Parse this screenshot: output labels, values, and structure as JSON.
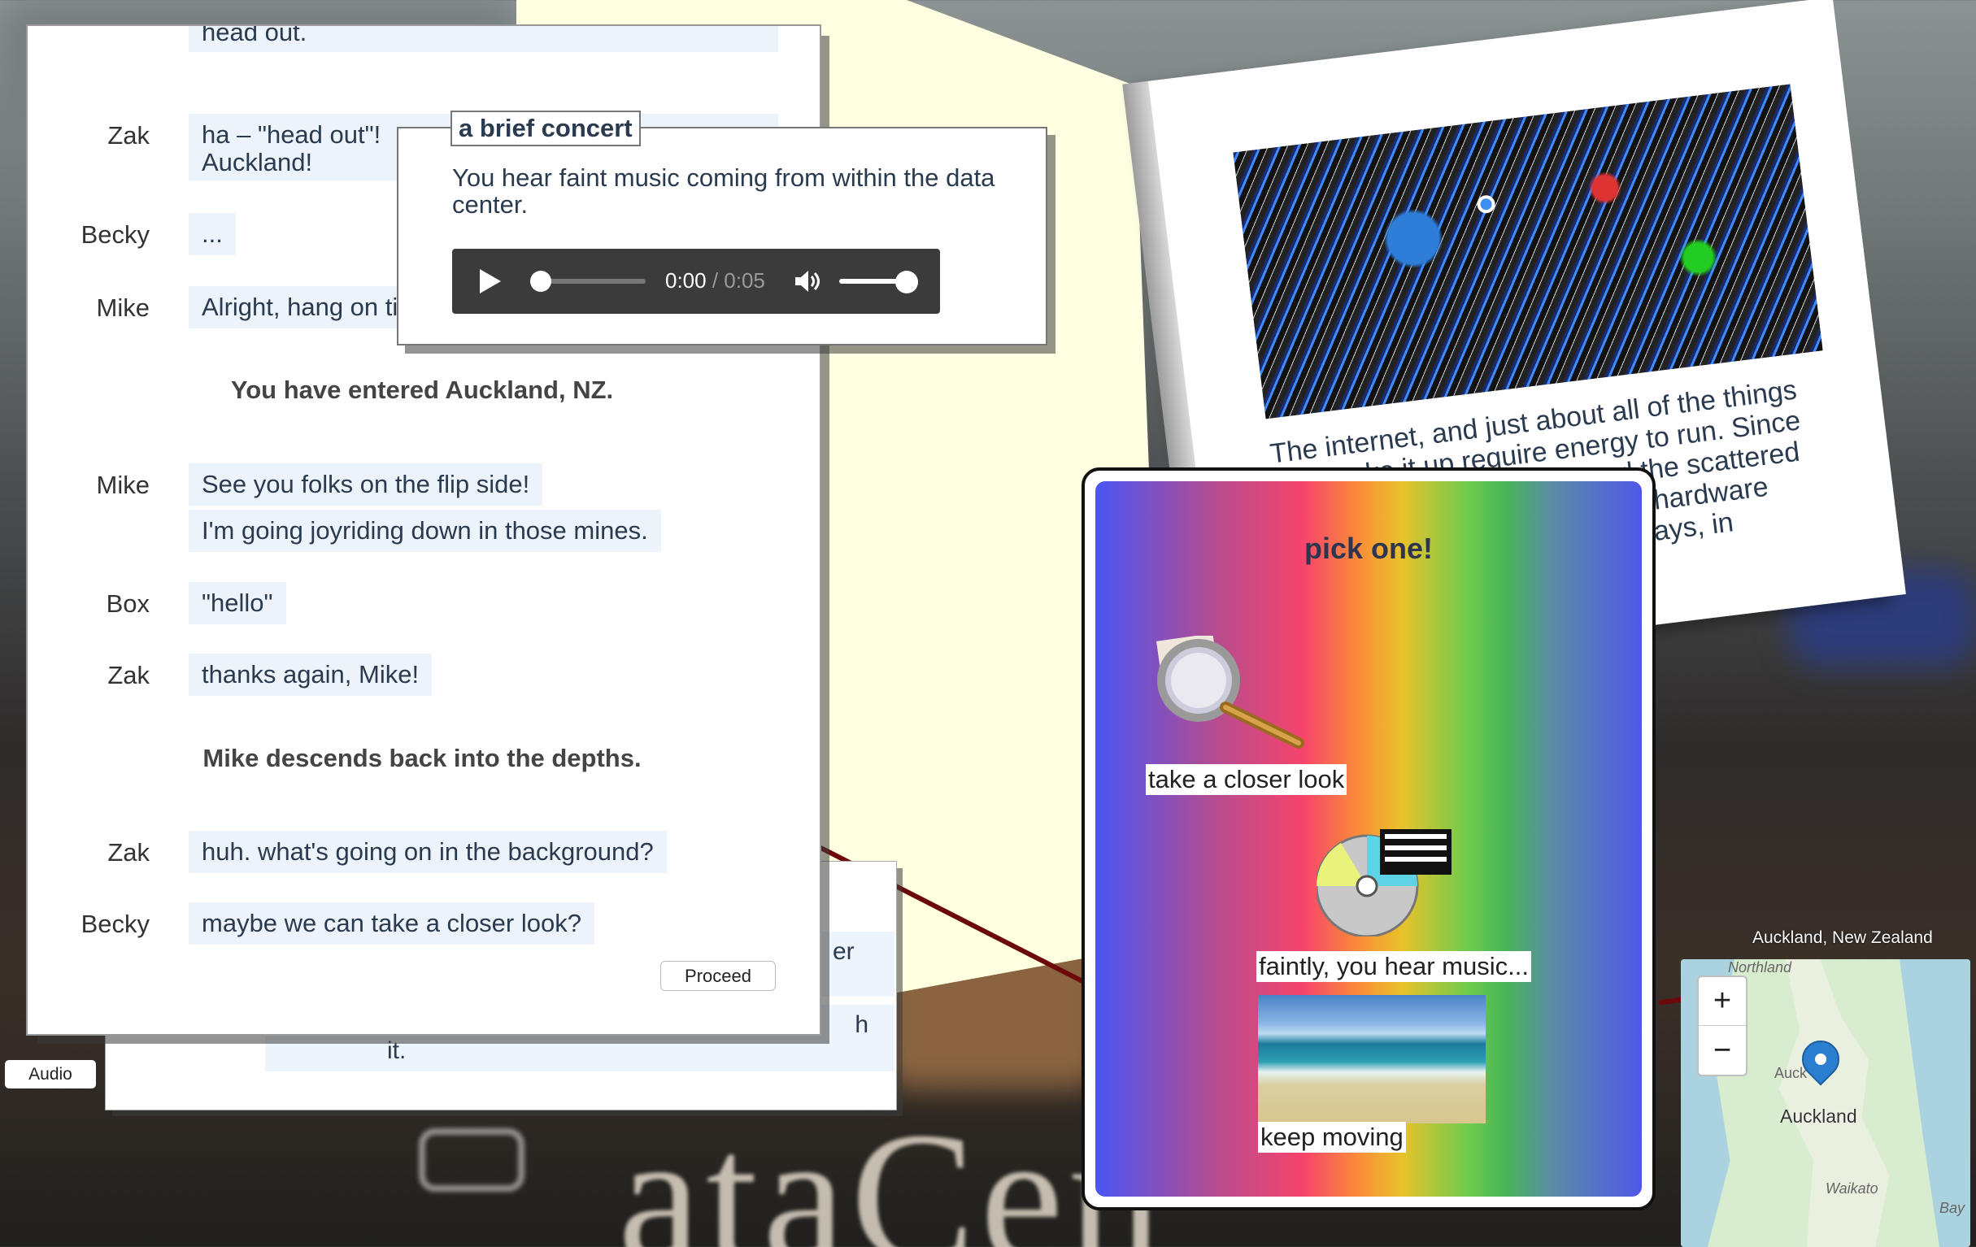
{
  "background": {
    "sign_text": "ataCen"
  },
  "book": {
    "text": "The internet, and just about all of the things that make it up require energy to run. Since computers, data centers, and the scattered all sorts of individual pieces of hardware draw local power in different ways, in different ways, the changes"
  },
  "side_button": {
    "label": "Audio"
  },
  "back_card": {
    "fragment_1": "er",
    "fragment_2": "h",
    "fragment_3": "it."
  },
  "dialog": {
    "top_fragment": "head out.",
    "lines": [
      {
        "speaker": "Zak",
        "text": "ha – \"head out\"! mean, lol. off to Auckland!"
      },
      {
        "speaker": "Becky",
        "text": "..."
      },
      {
        "speaker": "Mike",
        "text": "Alright, hang on tight!"
      },
      {
        "speaker": "Mike",
        "text": "See you folks on the flip side!"
      },
      {
        "speaker": "",
        "text": "I'm going joyriding down in those mines."
      },
      {
        "speaker": "Box",
        "text": "\"hello\""
      },
      {
        "speaker": "Zak",
        "text": "thanks again, Mike!"
      },
      {
        "speaker": "Zak",
        "text": "huh. what's going on in the background?"
      },
      {
        "speaker": "Becky",
        "text": "maybe we can take a closer look?"
      }
    ],
    "zak_line_1a": "ha – \"head out\"! ",
    "zak_line_1b": "Auckland!",
    "narration_1": "You have entered Auckland, NZ.",
    "narration_2": "Mike descends back into the depths.",
    "proceed_label": "Proceed"
  },
  "popup": {
    "title": "a brief concert",
    "text": "You hear faint music coming from within the data center.",
    "audio": {
      "current_time": "0:00",
      "separator": " / ",
      "duration": "0:05",
      "progress": 0.0,
      "volume": 1.0
    }
  },
  "pick": {
    "title": "pick one!",
    "options": [
      {
        "label": "take a closer look",
        "icon": "magnifying-glass-icon"
      },
      {
        "label": "faintly, you hear music...",
        "icon": "music-cd-icon"
      },
      {
        "label": "keep moving",
        "icon": "beach-image"
      }
    ]
  },
  "map": {
    "caption": "Auckland, New Zealand",
    "zoom_in": "+",
    "zoom_out": "−",
    "labels": {
      "region_north": "Northland",
      "city_partial": "Auck",
      "city": "Auckland",
      "region_south": "Waikato",
      "bay": "Bay"
    }
  }
}
